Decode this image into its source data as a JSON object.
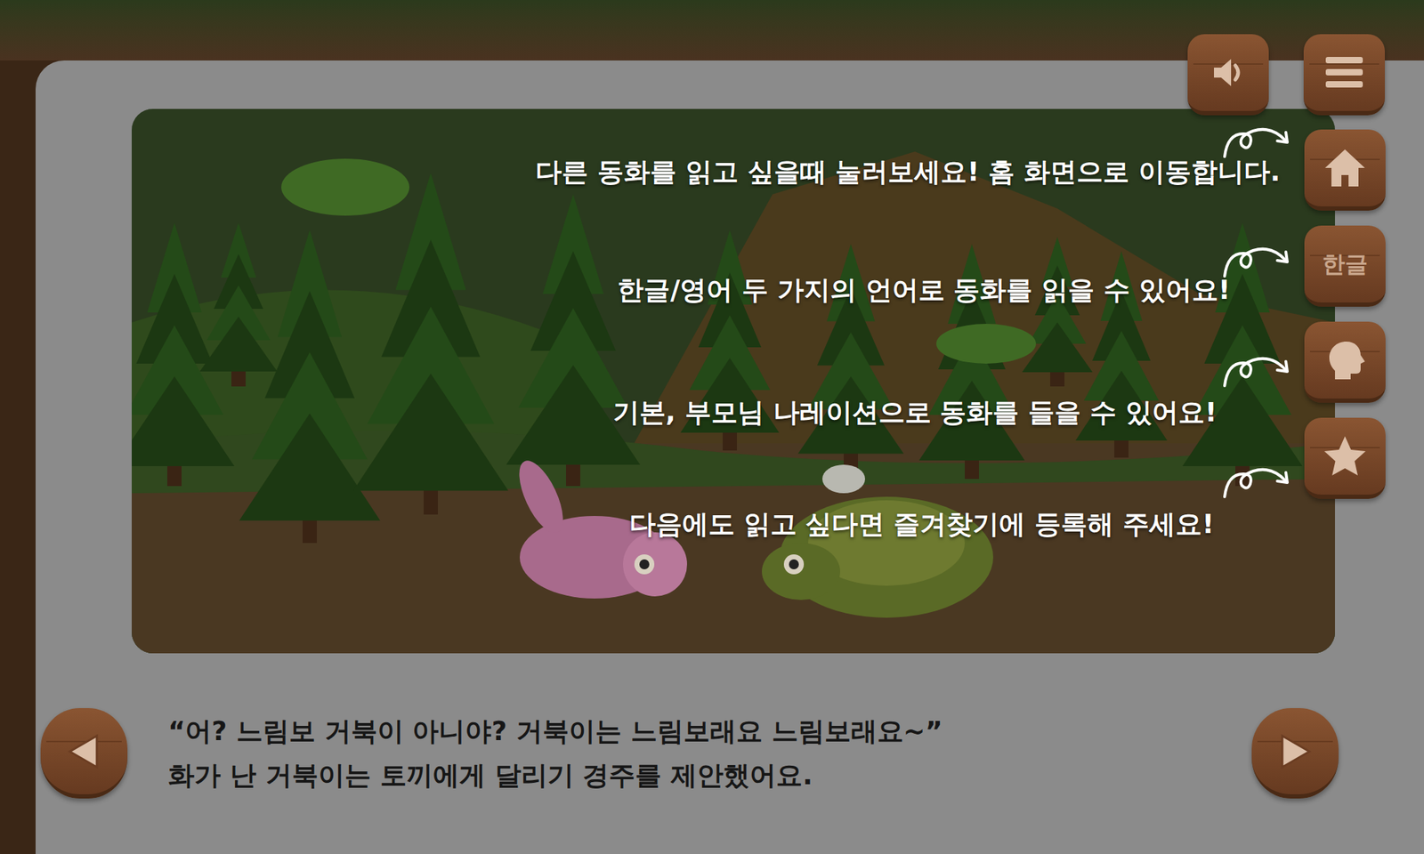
{
  "top_buttons": [
    {
      "kind": "sound"
    },
    {
      "kind": "menu"
    }
  ],
  "side_buttons": [
    {
      "kind": "home",
      "label": ""
    },
    {
      "kind": "language",
      "label": "한글"
    },
    {
      "kind": "narration",
      "label": ""
    },
    {
      "kind": "favorite",
      "label": ""
    }
  ],
  "tutorial": [
    {
      "text": "다른 동화를 읽고 싶을때 눌러보세요! 홈 화면으로 이동합니다."
    },
    {
      "text": "한글/영어 두 가지의 언어로 동화를 읽을 수 있어요!"
    },
    {
      "text": "기본, 부모님 나레이션으로 동화를 들을 수 있어요!"
    },
    {
      "text": "다음에도 읽고 싶다면 즐겨찾기에 등록해 주세요!"
    }
  ],
  "story": {
    "lines": [
      "“어? 느림보 거북이 아니야? 거북이는 느림보래요 느림보래요~”",
      "화가 난 거북이는 토끼에게 달리기 경주를 제안했어요."
    ]
  },
  "nav": [
    {
      "kind": "prev"
    },
    {
      "kind": "next"
    }
  ]
}
